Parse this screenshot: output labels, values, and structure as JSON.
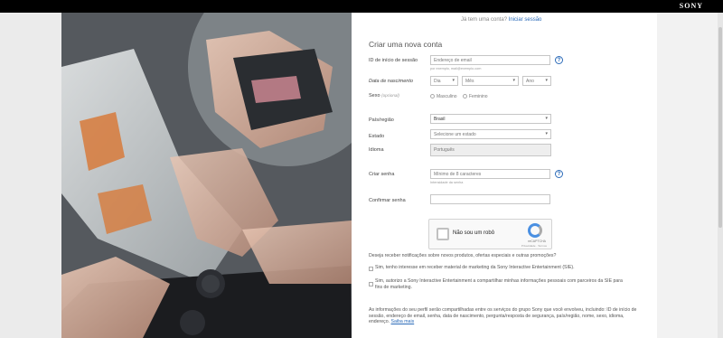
{
  "header": {
    "brand": "SONY"
  },
  "signin": {
    "question": "Já tem uma conta?",
    "link": "Iniciar sessão"
  },
  "form": {
    "title": "Criar uma nova conta",
    "signin_id": {
      "label": "ID de início de sessão",
      "placeholder": "Endereço de email",
      "hint": "por exemplo, mail@exemplo.com"
    },
    "dob": {
      "label": "Data de nascimento",
      "day": "Dia",
      "month": "Mês",
      "year": "Ano"
    },
    "gender": {
      "label": "Sexo",
      "optional": "(opcional)",
      "male": "Masculino",
      "female": "Feminino"
    },
    "country": {
      "label": "País/região",
      "value": "Brasil"
    },
    "state": {
      "label": "Estado",
      "value": "Selecione um estado"
    },
    "language": {
      "label": "Idioma",
      "value": "Português"
    },
    "password": {
      "label": "Criar senha",
      "placeholder": "Mínimo de 8 caracteres",
      "hint": "Intensidade da senha"
    },
    "confirm": {
      "label": "Confirmar senha"
    },
    "captcha": {
      "label": "Não sou um robô",
      "brand": "reCAPTCHA",
      "terms": "Privacidade · Termos"
    },
    "notify_question": "Deseja receber notificações sobre novos produtos, ofertas especiais e outras promoções?",
    "opt1": "Sim, tenho interesse em receber material de marketing da Sony Interactive Entertainment (SIE).",
    "opt2": "Sim, autorizo a Sony Interactive Entertainment a compartilhar minhas informações pessoais com parceiros da SIE para fins de marketing.",
    "footer": "As informações do seu perfil serão compartilhadas entre os serviços do grupo Sony que você envolveu, incluindo: ID de início de sessão, endereço de email, senha, data de nascimento, pergunta/resposta de segurança, país/região, nome, sexo, idioma, endereço.",
    "footer_link": "Saiba mais"
  }
}
